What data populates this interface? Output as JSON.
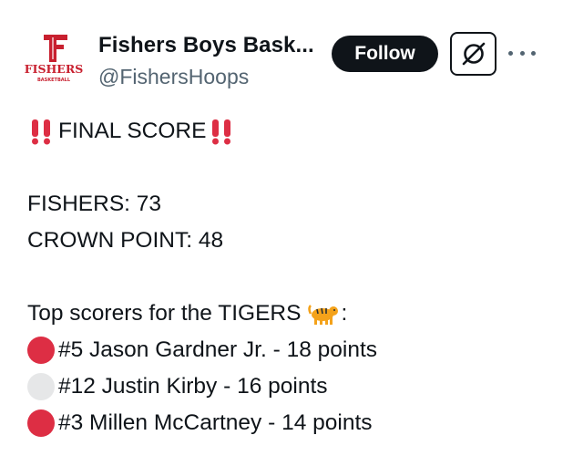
{
  "author": {
    "name": "Fishers Boys Bask...",
    "handle": "@FishersHoops",
    "avatar_text": "FISHERS",
    "avatar_subtext": "BASKETBALL"
  },
  "actions": {
    "follow_label": "Follow",
    "grok_icon": "grok-icon",
    "more_icon": "more-dots-icon"
  },
  "tweet": {
    "headline": "FINAL SCORE",
    "score_lines": [
      "FISHERS: 73",
      "CROWN POINT: 48"
    ],
    "scorers_intro": "Top scorers for the TIGERS",
    "scorers_intro_suffix": ":",
    "scorers": [
      {
        "text": "#5 Jason Gardner Jr. - 18 points",
        "circle_color": "#dd2e44"
      },
      {
        "text": "#12 Justin Kirby - 16 points",
        "circle_color": "#e6e7e8"
      },
      {
        "text": "#3 Millen McCartney - 14 points",
        "circle_color": "#dd2e44"
      }
    ]
  },
  "colors": {
    "text": "#0f1419",
    "secondary_text": "#536471",
    "follow_bg": "#0f1419",
    "brand_red": "#c8202f"
  }
}
